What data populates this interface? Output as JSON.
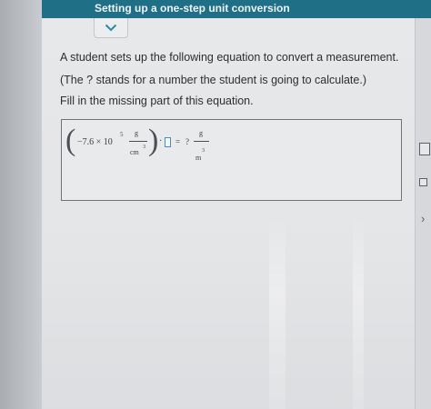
{
  "header": {
    "title": "Setting up a one-step unit conversion"
  },
  "question": {
    "line1": "A student sets up the following equation to convert a measurement.",
    "line2": "(The ? stands for a number the student is going to calculate.)",
    "line3": "Fill in the missing part of this equation."
  },
  "equation": {
    "coefficient": "−7.6 × 10",
    "exponent": "5",
    "left_unit_numerator": "g",
    "left_unit_denominator": "cm",
    "left_unit_denominator_exponent": "3",
    "dot": "·",
    "equals": "=",
    "unknown": "?",
    "right_unit_numerator": "g",
    "right_unit_denominator": "m",
    "right_unit_denominator_exponent": "3"
  },
  "icons": {
    "collapse": "chevron-down-icon",
    "side_chevron": "chevron-right-icon"
  },
  "colors": {
    "header_bg": "#1f6f86",
    "answer_blank_border": "#4a8bd0"
  }
}
